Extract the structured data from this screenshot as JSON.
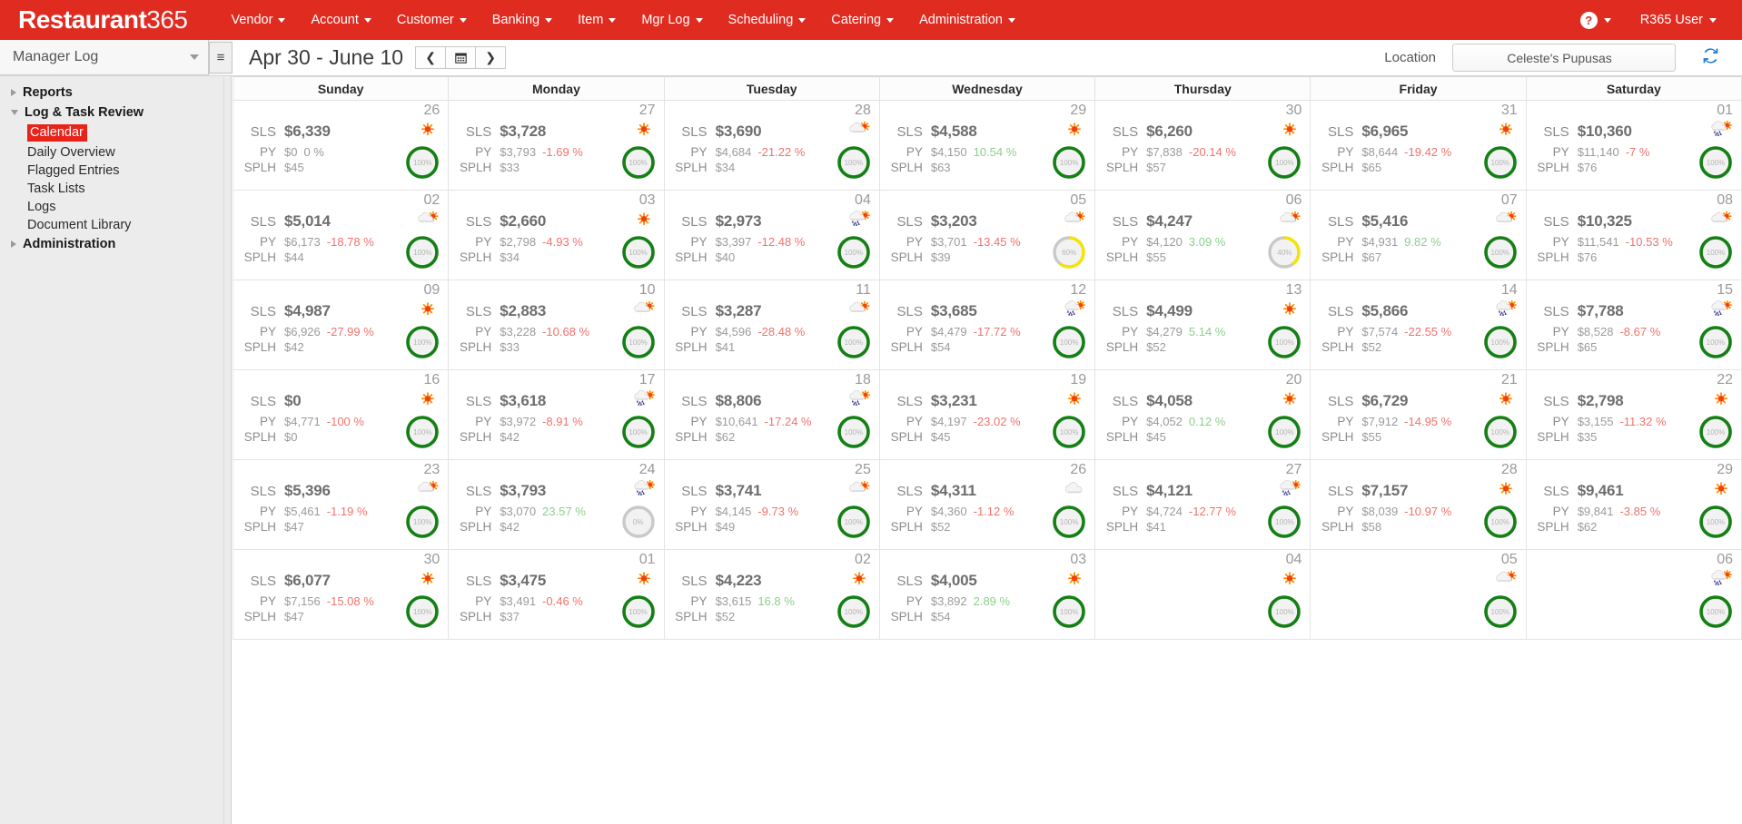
{
  "topnav": {
    "brand_bold": "Restaurant",
    "brand_thin": "365",
    "items": [
      {
        "label": "Vendor"
      },
      {
        "label": "Account"
      },
      {
        "label": "Customer"
      },
      {
        "label": "Banking"
      },
      {
        "label": "Item"
      },
      {
        "label": "Mgr Log"
      },
      {
        "label": "Scheduling"
      },
      {
        "label": "Catering"
      },
      {
        "label": "Administration"
      }
    ],
    "help_glyph": "?",
    "user_label": "R365 User"
  },
  "toolbar": {
    "module_label": "Manager Log",
    "hamburger_glyph": "≡",
    "date_range": "Apr 30 - June 10",
    "prev_glyph": "❮",
    "calendar_glyph": "▦",
    "next_glyph": "❯",
    "location_label": "Location",
    "location_value": "Celeste's Pupusas",
    "refresh_glyph": "↻"
  },
  "sidebar": {
    "groups": [
      {
        "label": "Reports",
        "expanded": false,
        "children": []
      },
      {
        "label": "Log & Task Review",
        "expanded": true,
        "children": [
          {
            "label": "Calendar",
            "active": true
          },
          {
            "label": "Daily Overview",
            "active": false
          },
          {
            "label": "Flagged Entries",
            "active": false
          },
          {
            "label": "Task Lists",
            "active": false
          },
          {
            "label": "Logs",
            "active": false
          },
          {
            "label": "Document Library",
            "active": false
          }
        ]
      },
      {
        "label": "Administration",
        "expanded": false,
        "children": []
      }
    ]
  },
  "calendar": {
    "weekday_headers": [
      "Sunday",
      "Monday",
      "Tuesday",
      "Wednesday",
      "Thursday",
      "Friday",
      "Saturday"
    ],
    "labels": {
      "sls": "SLS",
      "py": "PY",
      "splh": "SPLH"
    },
    "weeks": [
      [
        {
          "day": "26",
          "weather": "sun",
          "ring": 100,
          "sls": "$6,339",
          "py": "$0",
          "pct": "0 %",
          "pct_sign": "zero",
          "splh": "$45"
        },
        {
          "day": "27",
          "weather": "sun",
          "ring": 100,
          "sls": "$3,728",
          "py": "$3,793",
          "pct": "-1.69 %",
          "pct_sign": "neg",
          "splh": "$33"
        },
        {
          "day": "28",
          "weather": "partly",
          "ring": 100,
          "sls": "$3,690",
          "py": "$4,684",
          "pct": "-21.22 %",
          "pct_sign": "neg",
          "splh": "$34"
        },
        {
          "day": "29",
          "weather": "sun",
          "ring": 100,
          "sls": "$4,588",
          "py": "$4,150",
          "pct": "10.54 %",
          "pct_sign": "pos",
          "splh": "$63"
        },
        {
          "day": "30",
          "weather": "sun",
          "ring": 100,
          "sls": "$6,260",
          "py": "$7,838",
          "pct": "-20.14 %",
          "pct_sign": "neg",
          "splh": "$57"
        },
        {
          "day": "31",
          "weather": "sun",
          "ring": 100,
          "sls": "$6,965",
          "py": "$8,644",
          "pct": "-19.42 %",
          "pct_sign": "neg",
          "splh": "$65"
        },
        {
          "day": "01",
          "weather": "rain",
          "ring": 100,
          "sls": "$10,360",
          "py": "$11,140",
          "pct": "-7 %",
          "pct_sign": "neg",
          "splh": "$76"
        }
      ],
      [
        {
          "day": "02",
          "weather": "partly",
          "ring": 100,
          "sls": "$5,014",
          "py": "$6,173",
          "pct": "-18.78 %",
          "pct_sign": "neg",
          "splh": "$44"
        },
        {
          "day": "03",
          "weather": "sun",
          "ring": 100,
          "sls": "$2,660",
          "py": "$2,798",
          "pct": "-4.93 %",
          "pct_sign": "neg",
          "splh": "$34"
        },
        {
          "day": "04",
          "weather": "rain",
          "ring": 100,
          "sls": "$2,973",
          "py": "$3,397",
          "pct": "-12.48 %",
          "pct_sign": "neg",
          "splh": "$40"
        },
        {
          "day": "05",
          "weather": "partly",
          "ring": 60,
          "sls": "$3,203",
          "py": "$3,701",
          "pct": "-13.45 %",
          "pct_sign": "neg",
          "splh": "$39"
        },
        {
          "day": "06",
          "weather": "partly",
          "ring": 40,
          "sls": "$4,247",
          "py": "$4,120",
          "pct": "3.09 %",
          "pct_sign": "pos",
          "splh": "$55"
        },
        {
          "day": "07",
          "weather": "partly",
          "ring": 100,
          "sls": "$5,416",
          "py": "$4,931",
          "pct": "9.82 %",
          "pct_sign": "pos",
          "splh": "$67"
        },
        {
          "day": "08",
          "weather": "partly",
          "ring": 100,
          "sls": "$10,325",
          "py": "$11,541",
          "pct": "-10.53 %",
          "pct_sign": "neg",
          "splh": "$76"
        }
      ],
      [
        {
          "day": "09",
          "weather": "sun",
          "ring": 100,
          "sls": "$4,987",
          "py": "$6,926",
          "pct": "-27.99 %",
          "pct_sign": "neg",
          "splh": "$42"
        },
        {
          "day": "10",
          "weather": "partly",
          "ring": 100,
          "sls": "$2,883",
          "py": "$3,228",
          "pct": "-10.68 %",
          "pct_sign": "neg",
          "splh": "$33"
        },
        {
          "day": "11",
          "weather": "partly",
          "ring": 100,
          "sls": "$3,287",
          "py": "$4,596",
          "pct": "-28.48 %",
          "pct_sign": "neg",
          "splh": "$41"
        },
        {
          "day": "12",
          "weather": "rain",
          "ring": 100,
          "sls": "$3,685",
          "py": "$4,479",
          "pct": "-17.72 %",
          "pct_sign": "neg",
          "splh": "$54"
        },
        {
          "day": "13",
          "weather": "sun",
          "ring": 100,
          "sls": "$4,499",
          "py": "$4,279",
          "pct": "5.14 %",
          "pct_sign": "pos",
          "splh": "$52"
        },
        {
          "day": "14",
          "weather": "rain",
          "ring": 100,
          "sls": "$5,866",
          "py": "$7,574",
          "pct": "-22.55 %",
          "pct_sign": "neg",
          "splh": "$52"
        },
        {
          "day": "15",
          "weather": "rain",
          "ring": 100,
          "sls": "$7,788",
          "py": "$8,528",
          "pct": "-8.67 %",
          "pct_sign": "neg",
          "splh": "$65"
        }
      ],
      [
        {
          "day": "16",
          "weather": "sun",
          "ring": 100,
          "sls": "$0",
          "py": "$4,771",
          "pct": "-100 %",
          "pct_sign": "neg",
          "splh": "$0"
        },
        {
          "day": "17",
          "weather": "rain",
          "ring": 100,
          "sls": "$3,618",
          "py": "$3,972",
          "pct": "-8.91 %",
          "pct_sign": "neg",
          "splh": "$42"
        },
        {
          "day": "18",
          "weather": "rain",
          "ring": 100,
          "sls": "$8,806",
          "py": "$10,641",
          "pct": "-17.24 %",
          "pct_sign": "neg",
          "splh": "$62"
        },
        {
          "day": "19",
          "weather": "sun",
          "ring": 100,
          "sls": "$3,231",
          "py": "$4,197",
          "pct": "-23.02 %",
          "pct_sign": "neg",
          "splh": "$45"
        },
        {
          "day": "20",
          "weather": "sun",
          "ring": 100,
          "sls": "$4,058",
          "py": "$4,052",
          "pct": "0.12 %",
          "pct_sign": "pos",
          "splh": "$45"
        },
        {
          "day": "21",
          "weather": "sun",
          "ring": 100,
          "sls": "$6,729",
          "py": "$7,912",
          "pct": "-14.95 %",
          "pct_sign": "neg",
          "splh": "$55"
        },
        {
          "day": "22",
          "weather": "sun",
          "ring": 100,
          "sls": "$2,798",
          "py": "$3,155",
          "pct": "-11.32 %",
          "pct_sign": "neg",
          "splh": "$35"
        }
      ],
      [
        {
          "day": "23",
          "weather": "partly",
          "ring": 100,
          "sls": "$5,396",
          "py": "$5,461",
          "pct": "-1.19 %",
          "pct_sign": "neg",
          "splh": "$47"
        },
        {
          "day": "24",
          "weather": "rain",
          "ring": 0,
          "sls": "$3,793",
          "py": "$3,070",
          "pct": "23.57 %",
          "pct_sign": "pos",
          "splh": "$42"
        },
        {
          "day": "25",
          "weather": "partly",
          "ring": 100,
          "sls": "$3,741",
          "py": "$4,145",
          "pct": "-9.73 %",
          "pct_sign": "neg",
          "splh": "$49"
        },
        {
          "day": "26",
          "weather": "cloud",
          "ring": 100,
          "sls": "$4,311",
          "py": "$4,360",
          "pct": "-1.12 %",
          "pct_sign": "neg",
          "splh": "$52"
        },
        {
          "day": "27",
          "weather": "rain",
          "ring": 100,
          "sls": "$4,121",
          "py": "$4,724",
          "pct": "-12.77 %",
          "pct_sign": "neg",
          "splh": "$41"
        },
        {
          "day": "28",
          "weather": "sun",
          "ring": 100,
          "sls": "$7,157",
          "py": "$8,039",
          "pct": "-10.97 %",
          "pct_sign": "neg",
          "splh": "$58"
        },
        {
          "day": "29",
          "weather": "sun",
          "ring": 100,
          "sls": "$9,461",
          "py": "$9,841",
          "pct": "-3.85 %",
          "pct_sign": "neg",
          "splh": "$62"
        }
      ],
      [
        {
          "day": "30",
          "weather": "sun",
          "ring": 100,
          "sls": "$6,077",
          "py": "$7,156",
          "pct": "-15.08 %",
          "pct_sign": "neg",
          "splh": "$47"
        },
        {
          "day": "01",
          "weather": "sun",
          "ring": 100,
          "sls": "$3,475",
          "py": "$3,491",
          "pct": "-0.46 %",
          "pct_sign": "neg",
          "splh": "$37"
        },
        {
          "day": "02",
          "weather": "sun",
          "ring": 100,
          "sls": "$4,223",
          "py": "$3,615",
          "pct": "16.8 %",
          "pct_sign": "pos",
          "splh": "$52"
        },
        {
          "day": "03",
          "weather": "sun",
          "ring": 100,
          "sls": "$4,005",
          "py": "$3,892",
          "pct": "2.89 %",
          "pct_sign": "pos",
          "splh": "$54"
        },
        {
          "day": "04",
          "weather": "sun",
          "ring": 100,
          "sls": "",
          "py": "",
          "pct": "",
          "pct_sign": "zero",
          "splh": ""
        },
        {
          "day": "05",
          "weather": "partly",
          "ring": 100,
          "sls": "",
          "py": "",
          "pct": "",
          "pct_sign": "zero",
          "splh": ""
        },
        {
          "day": "06",
          "weather": "rain",
          "ring": 100,
          "sls": "",
          "py": "",
          "pct": "",
          "pct_sign": "zero",
          "splh": ""
        }
      ]
    ]
  },
  "colors": {
    "brand_red": "#e02b20",
    "ring_green": "#148014",
    "ring_yellow": "#f5e400",
    "ring_grey": "#c9c9c9",
    "negative": "#f0726c",
    "positive": "#8cd08c"
  }
}
